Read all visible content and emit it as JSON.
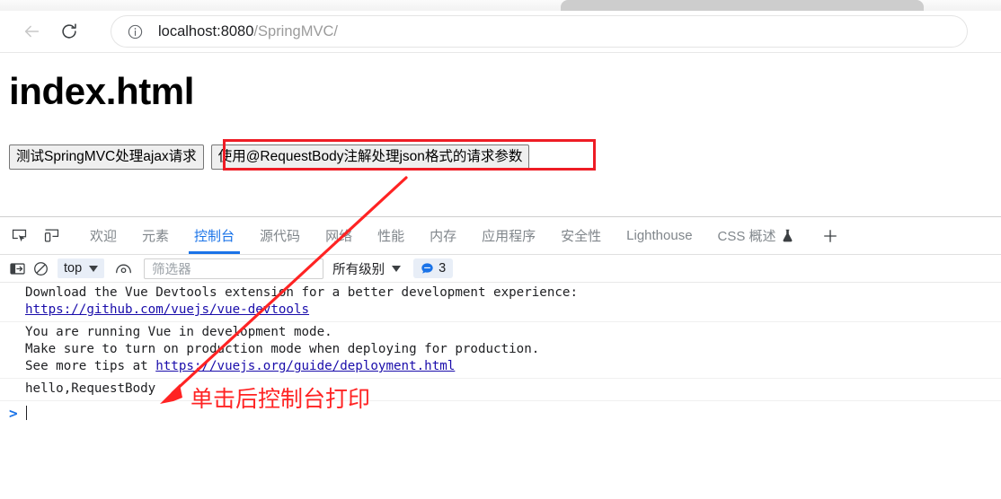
{
  "browser": {
    "back_icon": "arrow-left-icon",
    "reload_icon": "reload-icon",
    "info_icon": "info-circle-icon",
    "url_host": "localhost:8080",
    "url_path": "/SpringMVC/"
  },
  "page": {
    "title": "index.html",
    "buttons": [
      {
        "label": "测试SpringMVC处理ajax请求",
        "highlighted": false
      },
      {
        "label": "使用@RequestBody注解处理json格式的请求参数",
        "highlighted": true
      }
    ]
  },
  "devtools": {
    "inspect_icon": "inspect-element-icon",
    "device_icon": "device-toolbar-icon",
    "add_tab_label": "+",
    "tabs": [
      {
        "label": "欢迎",
        "active": false
      },
      {
        "label": "元素",
        "active": false
      },
      {
        "label": "控制台",
        "active": true
      },
      {
        "label": "源代码",
        "active": false
      },
      {
        "label": "网络",
        "active": false
      },
      {
        "label": "性能",
        "active": false
      },
      {
        "label": "内存",
        "active": false
      },
      {
        "label": "应用程序",
        "active": false
      },
      {
        "label": "安全性",
        "active": false
      },
      {
        "label": "Lighthouse",
        "active": false
      },
      {
        "label": "CSS 概述",
        "active": false,
        "icon": "flask-icon"
      }
    ],
    "console_toolbar": {
      "sidebar_icon": "console-sidebar-icon",
      "clear_icon": "clear-console-icon",
      "context_label": "top",
      "eye_icon": "live-expression-eye-icon",
      "filter_placeholder": "筛选器",
      "filter_value": "",
      "levels_label": "所有级别",
      "issues_icon": "issues-speech-bubble-icon",
      "issues_count": "3",
      "accent_color": "#1a73e8"
    },
    "console_messages": [
      {
        "lines": [
          "Download the Vue Devtools extension for a better development experience:"
        ],
        "link": "https://github.com/vuejs/vue-devtools"
      },
      {
        "lines": [
          "You are running Vue in development mode.",
          "Make sure to turn on production mode when deploying for production."
        ],
        "link_prefix": "See more tips at ",
        "link": "https://vuejs.org/guide/deployment.html"
      },
      {
        "lines": [
          "hello,RequestBody"
        ]
      }
    ],
    "prompt_chevron": ">"
  },
  "annotation": {
    "text": "单击后控制台打印",
    "color": "#ff2323",
    "arrow_name": "red-arrow-annotation",
    "highlight_box_name": "red-highlight-box"
  }
}
